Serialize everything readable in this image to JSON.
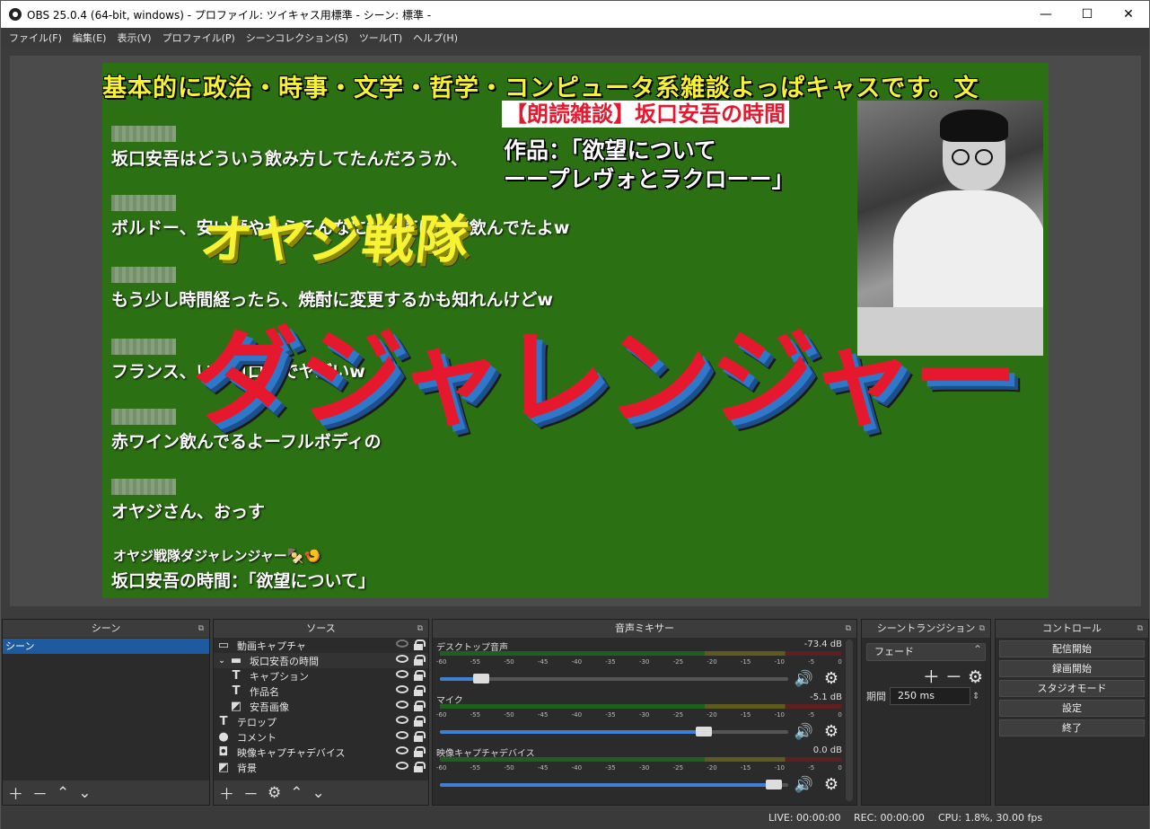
{
  "window": {
    "title": "OBS 25.0.4 (64-bit, windows) - プロファイル: ツイキャス用標準 - シーン: 標準 -",
    "minimize": "—",
    "maximize": "☐",
    "close": "✕"
  },
  "menu": [
    "ファイル(F)",
    "編集(E)",
    "表示(V)",
    "プロファイル(P)",
    "シーンコレクション(S)",
    "ツール(T)",
    "ヘルプ(H)"
  ],
  "preview": {
    "scroll_text": "基本的に政治・時事・文学・哲学・コンピュータ系雑談よっぱキャスです。文",
    "comments": [
      "坂口安吾はどういう飲み方してたんだろうか、",
      "ボルドー、安い酒やからそんなに地方気にせず飲んでたよw",
      "もう少し時間経ったら、焼酎に変更するかも知れんけどw",
      "フランス、いまコロナでヤバいw",
      "赤ワイン飲んでるよーフルボディの",
      "オヤジさん、おっす"
    ],
    "title_line1": "オヤジ戦隊",
    "title_line2": "ダジャレンジャー",
    "reading_title": "【朗読雑談】坂口安吾の時間",
    "work_line1": "作品：「欲望について",
    "work_line2": "ーープレヴォとラクローー」",
    "footer_line1": "オヤジ戦隊ダジャレンジャー🍢🍤",
    "footer_line2": "坂口安吾の時間：「欲望について」"
  },
  "docks": {
    "scenes": {
      "title": "シーン",
      "items": [
        "シーン"
      ]
    },
    "sources": {
      "title": "ソース",
      "items": [
        {
          "name": "動画キャプチャ",
          "icon": "monitor-icon",
          "visible": false
        },
        {
          "name": "坂口安吾の時間",
          "icon": "folder-icon",
          "visible": true
        },
        {
          "name": "キャプション",
          "icon": "text-icon",
          "visible": true
        },
        {
          "name": "作品名",
          "icon": "text-icon",
          "visible": true
        },
        {
          "name": "安吾画像",
          "icon": "image-icon",
          "visible": true
        },
        {
          "name": "テロップ",
          "icon": "text-icon",
          "visible": true
        },
        {
          "name": "コメント",
          "icon": "globe-icon",
          "visible": true
        },
        {
          "name": "映像キャプチャデバイス",
          "icon": "camera-icon",
          "visible": true
        },
        {
          "name": "背景",
          "icon": "image-icon",
          "visible": true
        }
      ]
    },
    "mixer": {
      "title": "音声ミキサー",
      "ticks": [
        "-60",
        "-55",
        "-50",
        "-45",
        "-40",
        "-35",
        "-30",
        "-25",
        "-20",
        "-15",
        "-10",
        "-5",
        "0"
      ],
      "channels": [
        {
          "name": "デスクトップ音声",
          "db": "-73.4 dB",
          "level": 0.1
        },
        {
          "name": "マイク",
          "db": "-5.1 dB",
          "level": 0.77
        },
        {
          "name": "映像キャプチャデバイス",
          "db": "0.0 dB",
          "level": 0.98
        }
      ]
    },
    "transitions": {
      "title": "シーントランジション",
      "selected": "フェード",
      "duration_label": "期間",
      "duration_value": "250 ms"
    },
    "controls": {
      "title": "コントロール",
      "buttons": [
        "配信開始",
        "録画開始",
        "スタジオモード",
        "設定",
        "終了"
      ]
    }
  },
  "status": {
    "live": "LIVE: 00:00:00",
    "rec": "REC: 00:00:00",
    "cpu": "CPU: 1.8%, 30.00 fps"
  }
}
